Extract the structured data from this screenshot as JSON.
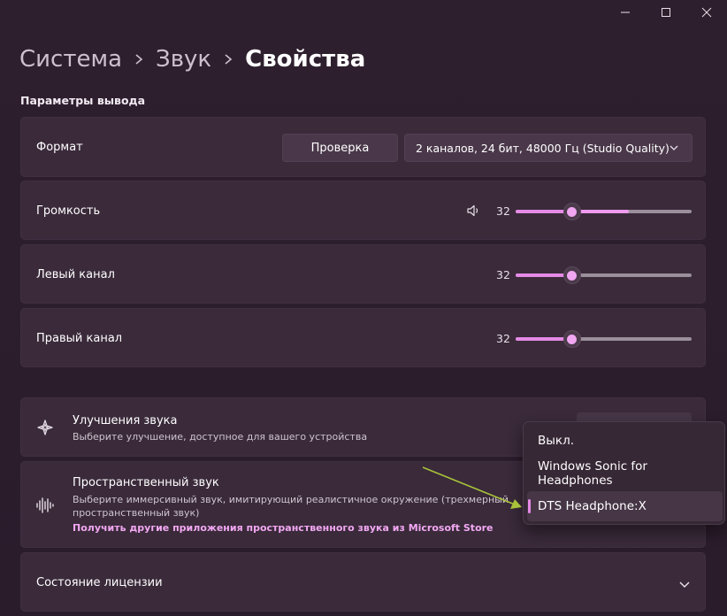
{
  "window_controls": {
    "minimize": "minimize-icon",
    "maximize": "maximize-icon",
    "close": "close-icon"
  },
  "breadcrumb": {
    "items": [
      "Система",
      "Звук",
      "Свойства"
    ]
  },
  "section_title": "Параметры вывода",
  "format": {
    "label": "Формат",
    "test_button": "Проверка",
    "selected": "2 каналов, 24 бит, 48000 Гц (Studio Quality)"
  },
  "volume": {
    "label": "Громкость",
    "value": "32",
    "level_percent": 32,
    "icon": "speaker-icon"
  },
  "left_channel": {
    "label": "Левый канал",
    "value": "32",
    "level_percent": 32
  },
  "right_channel": {
    "label": "Правый канал",
    "value": "32",
    "level_percent": 32
  },
  "enhancements": {
    "title": "Улучшения звука",
    "description": "Выберите улучшение, доступное для вашего устройства",
    "icon": "sparkle-icon"
  },
  "spatial": {
    "title": "Пространственный звук",
    "description_line1": "Выберите иммерсивный звук, имитирующий реалистичное окружение (трехмерный",
    "description_line2": "пространственный звук)",
    "store_link": "Получить другие приложения пространственного звука из Microsoft Store",
    "icon": "spatial-audio-icon"
  },
  "spatial_menu": {
    "options": [
      "Выкл.",
      "Windows Sonic for Headphones",
      "DTS Headphone:X"
    ],
    "selected": "DTS Headphone:X"
  },
  "license": {
    "label": "Состояние лицензии"
  },
  "colors": {
    "accent": "#e58ae5",
    "background": "#2b1d2b",
    "card": "#3a2a3a",
    "annotation_arrow": "#a8c23a"
  }
}
